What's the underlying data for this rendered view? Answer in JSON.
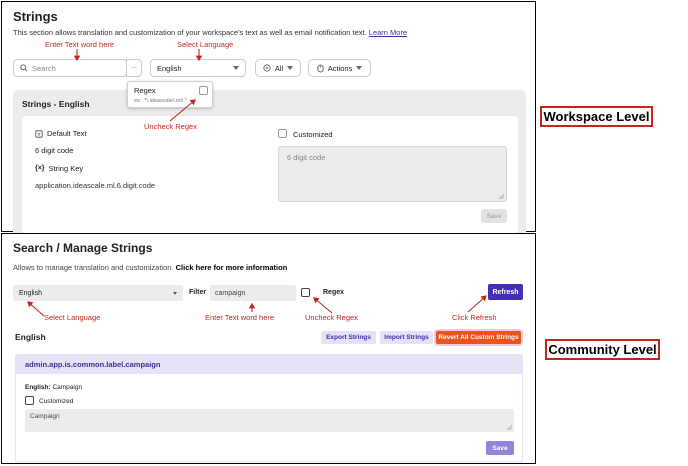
{
  "workspace": {
    "title": "Strings",
    "description": "This section allows translation and customization of your workspace's text as well as email notification text.",
    "learn_more": "Learn More",
    "search_placeholder": "Search",
    "more_label": "···",
    "language": "English",
    "filter_all": "All",
    "actions": "Actions",
    "regex_title": "Regex",
    "regex_example": "ex: .*\\.ideascale\\.ml\\.*",
    "section_title": "Strings - English",
    "default_text_label": "Default Text",
    "default_text_value": "6 digit code",
    "string_key_label": "String Key",
    "string_key_value": "application.ideascale.ml.6.digit.code",
    "customized_label": "Customized",
    "textarea_placeholder": "6 digit code",
    "save": "Save"
  },
  "workspace_annotations": {
    "enter_text": "Enter Text word here",
    "select_language": "Select Language",
    "uncheck_regex": "Uncheck Regex"
  },
  "community": {
    "title": "Search / Manage Strings",
    "description": "Allows to manage translation and customization.",
    "click_here": "Click here for more information",
    "language": "English",
    "filter_label": "Filter",
    "filter_value": "campaign",
    "regex_label": "Regex",
    "refresh": "Refresh",
    "section_title": "English",
    "export": "Export Strings",
    "import": "Import Strings",
    "revert": "Revert All Custom Strings",
    "key": "admin.app.is.common.label.campaign",
    "english_label": "English:",
    "english_value": "Campaign",
    "customized_label": "Customized",
    "textarea_value": "Campaign",
    "save": "Save"
  },
  "community_annotations": {
    "select_language": "Select Language",
    "enter_text": "Enter Text word here",
    "uncheck_regex": "Uncheck Regex",
    "click_refresh": "Click Refresh"
  },
  "labels": {
    "workspace_level": "Workspace Level",
    "community_level": "Community Level"
  },
  "colors": {
    "annotation_red": "#c0281c",
    "refresh_button": "#4530b5",
    "revert_button": "#e8541c",
    "community_key": "#3b3190",
    "save_button_community": "#8f86d6"
  }
}
